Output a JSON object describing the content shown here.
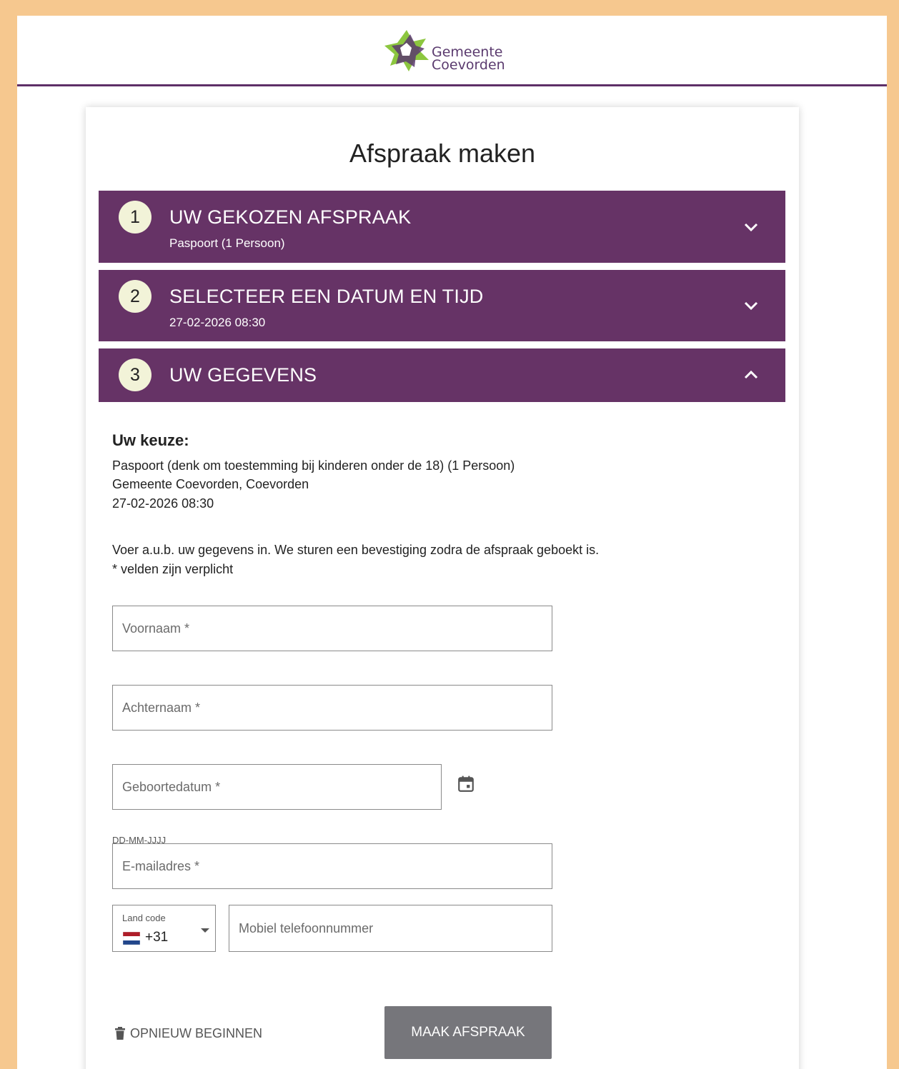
{
  "header": {
    "logo_line1": "Gemeente",
    "logo_line2": "Coevorden"
  },
  "page": {
    "title": "Afspraak maken"
  },
  "steps": [
    {
      "number": "1",
      "title": "UW GEKOZEN AFSPRAAK",
      "subtitle": "Paspoort (1 Persoon)",
      "expanded": false,
      "icon": "chevron-down-icon"
    },
    {
      "number": "2",
      "title": "SELECTEER EEN DATUM EN TIJD",
      "subtitle": "27-02-2026 08:30",
      "expanded": false,
      "icon": "chevron-down-icon"
    },
    {
      "number": "3",
      "title": "UW GEGEVENS",
      "subtitle": "",
      "expanded": true,
      "icon": "chevron-up-icon"
    }
  ],
  "details": {
    "heading": "Uw keuze:",
    "lines": [
      "Paspoort (denk om toestemming bij kinderen onder de 18) (1 Persoon)",
      "Gemeente Coevorden, Coevorden",
      "27-02-2026 08:30"
    ],
    "instruction": "Voer a.u.b. uw gegevens in. We sturen een bevestiging zodra de afspraak geboekt is.",
    "required_note": "* velden zijn verplicht"
  },
  "form": {
    "voornaam": {
      "value": "",
      "placeholder": "Voornaam *"
    },
    "achternaam": {
      "value": "",
      "placeholder": "Achternaam *"
    },
    "geboortedatum": {
      "value": "",
      "placeholder": "Geboortedatum *",
      "hint": "DD-MM-JJJJ"
    },
    "email": {
      "value": "",
      "placeholder": "E-mailadres *"
    },
    "land_code": {
      "label": "Land code",
      "value": "+31"
    },
    "mobiel": {
      "value": "",
      "placeholder": "Mobiel telefoonnummer"
    }
  },
  "actions": {
    "reset_label": "OPNIEUW BEGINNEN",
    "submit_label": "MAAK AFSPRAAK"
  },
  "colors": {
    "accent": "#663366",
    "header_border": "#5e2f67",
    "step_number_bg": "#f2f3d8",
    "submit_bg": "#76767b",
    "page_border": "#f6c88f"
  }
}
